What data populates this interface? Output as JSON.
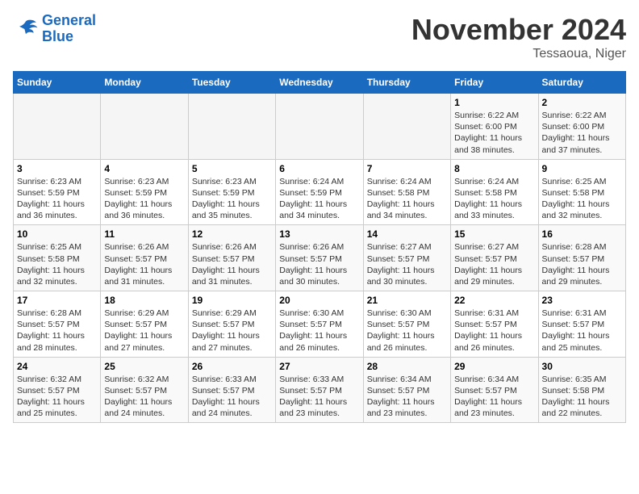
{
  "logo": {
    "line1": "General",
    "line2": "Blue"
  },
  "title": "November 2024",
  "location": "Tessaoua, Niger",
  "weekdays": [
    "Sunday",
    "Monday",
    "Tuesday",
    "Wednesday",
    "Thursday",
    "Friday",
    "Saturday"
  ],
  "weeks": [
    [
      {
        "day": "",
        "info": ""
      },
      {
        "day": "",
        "info": ""
      },
      {
        "day": "",
        "info": ""
      },
      {
        "day": "",
        "info": ""
      },
      {
        "day": "",
        "info": ""
      },
      {
        "day": "1",
        "info": "Sunrise: 6:22 AM\nSunset: 6:00 PM\nDaylight: 11 hours\nand 38 minutes."
      },
      {
        "day": "2",
        "info": "Sunrise: 6:22 AM\nSunset: 6:00 PM\nDaylight: 11 hours\nand 37 minutes."
      }
    ],
    [
      {
        "day": "3",
        "info": "Sunrise: 6:23 AM\nSunset: 5:59 PM\nDaylight: 11 hours\nand 36 minutes."
      },
      {
        "day": "4",
        "info": "Sunrise: 6:23 AM\nSunset: 5:59 PM\nDaylight: 11 hours\nand 36 minutes."
      },
      {
        "day": "5",
        "info": "Sunrise: 6:23 AM\nSunset: 5:59 PM\nDaylight: 11 hours\nand 35 minutes."
      },
      {
        "day": "6",
        "info": "Sunrise: 6:24 AM\nSunset: 5:59 PM\nDaylight: 11 hours\nand 34 minutes."
      },
      {
        "day": "7",
        "info": "Sunrise: 6:24 AM\nSunset: 5:58 PM\nDaylight: 11 hours\nand 34 minutes."
      },
      {
        "day": "8",
        "info": "Sunrise: 6:24 AM\nSunset: 5:58 PM\nDaylight: 11 hours\nand 33 minutes."
      },
      {
        "day": "9",
        "info": "Sunrise: 6:25 AM\nSunset: 5:58 PM\nDaylight: 11 hours\nand 32 minutes."
      }
    ],
    [
      {
        "day": "10",
        "info": "Sunrise: 6:25 AM\nSunset: 5:58 PM\nDaylight: 11 hours\nand 32 minutes."
      },
      {
        "day": "11",
        "info": "Sunrise: 6:26 AM\nSunset: 5:57 PM\nDaylight: 11 hours\nand 31 minutes."
      },
      {
        "day": "12",
        "info": "Sunrise: 6:26 AM\nSunset: 5:57 PM\nDaylight: 11 hours\nand 31 minutes."
      },
      {
        "day": "13",
        "info": "Sunrise: 6:26 AM\nSunset: 5:57 PM\nDaylight: 11 hours\nand 30 minutes."
      },
      {
        "day": "14",
        "info": "Sunrise: 6:27 AM\nSunset: 5:57 PM\nDaylight: 11 hours\nand 30 minutes."
      },
      {
        "day": "15",
        "info": "Sunrise: 6:27 AM\nSunset: 5:57 PM\nDaylight: 11 hours\nand 29 minutes."
      },
      {
        "day": "16",
        "info": "Sunrise: 6:28 AM\nSunset: 5:57 PM\nDaylight: 11 hours\nand 29 minutes."
      }
    ],
    [
      {
        "day": "17",
        "info": "Sunrise: 6:28 AM\nSunset: 5:57 PM\nDaylight: 11 hours\nand 28 minutes."
      },
      {
        "day": "18",
        "info": "Sunrise: 6:29 AM\nSunset: 5:57 PM\nDaylight: 11 hours\nand 27 minutes."
      },
      {
        "day": "19",
        "info": "Sunrise: 6:29 AM\nSunset: 5:57 PM\nDaylight: 11 hours\nand 27 minutes."
      },
      {
        "day": "20",
        "info": "Sunrise: 6:30 AM\nSunset: 5:57 PM\nDaylight: 11 hours\nand 26 minutes."
      },
      {
        "day": "21",
        "info": "Sunrise: 6:30 AM\nSunset: 5:57 PM\nDaylight: 11 hours\nand 26 minutes."
      },
      {
        "day": "22",
        "info": "Sunrise: 6:31 AM\nSunset: 5:57 PM\nDaylight: 11 hours\nand 26 minutes."
      },
      {
        "day": "23",
        "info": "Sunrise: 6:31 AM\nSunset: 5:57 PM\nDaylight: 11 hours\nand 25 minutes."
      }
    ],
    [
      {
        "day": "24",
        "info": "Sunrise: 6:32 AM\nSunset: 5:57 PM\nDaylight: 11 hours\nand 25 minutes."
      },
      {
        "day": "25",
        "info": "Sunrise: 6:32 AM\nSunset: 5:57 PM\nDaylight: 11 hours\nand 24 minutes."
      },
      {
        "day": "26",
        "info": "Sunrise: 6:33 AM\nSunset: 5:57 PM\nDaylight: 11 hours\nand 24 minutes."
      },
      {
        "day": "27",
        "info": "Sunrise: 6:33 AM\nSunset: 5:57 PM\nDaylight: 11 hours\nand 23 minutes."
      },
      {
        "day": "28",
        "info": "Sunrise: 6:34 AM\nSunset: 5:57 PM\nDaylight: 11 hours\nand 23 minutes."
      },
      {
        "day": "29",
        "info": "Sunrise: 6:34 AM\nSunset: 5:57 PM\nDaylight: 11 hours\nand 23 minutes."
      },
      {
        "day": "30",
        "info": "Sunrise: 6:35 AM\nSunset: 5:58 PM\nDaylight: 11 hours\nand 22 minutes."
      }
    ]
  ]
}
